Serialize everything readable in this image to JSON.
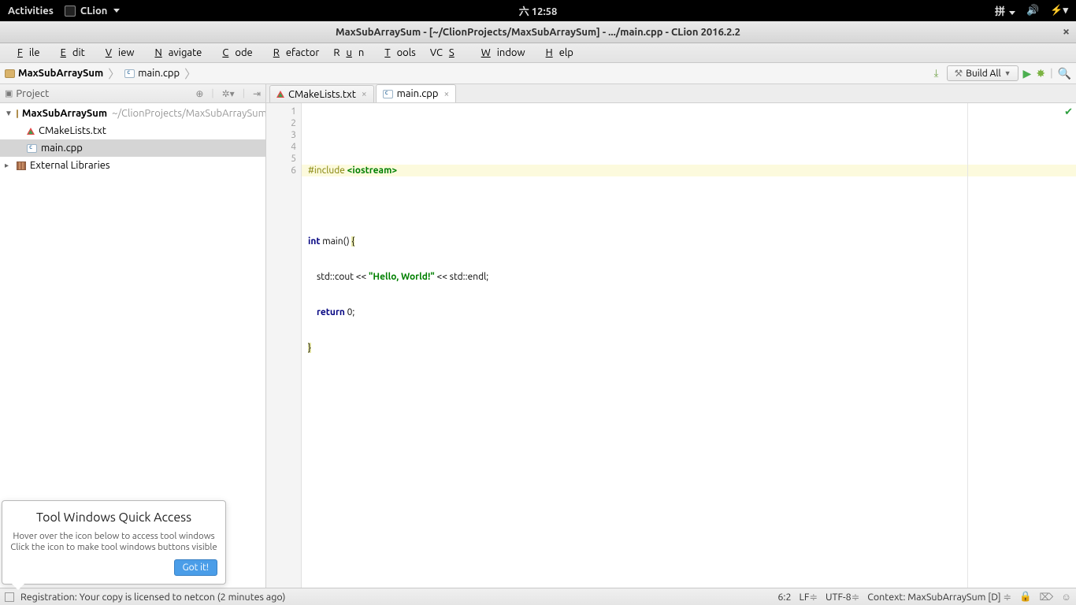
{
  "gnome": {
    "activities": "Activities",
    "app": "CLion",
    "clock": "六 12:58",
    "input": "拼"
  },
  "window": {
    "title": "MaxSubArraySum - [~/ClionProjects/MaxSubArraySum] - .../main.cpp - CLion 2016.2.2"
  },
  "menu": {
    "file": "File",
    "edit": "Edit",
    "view": "View",
    "navigate": "Navigate",
    "code": "Code",
    "refactor": "Refactor",
    "run": "Run",
    "tools": "Tools",
    "vcs": "VCS",
    "window": "Window",
    "help": "Help"
  },
  "breadcrumb": {
    "project": "MaxSubArraySum",
    "file": "main.cpp"
  },
  "toolbar": {
    "build_config": "Build All"
  },
  "project_pane": {
    "title": "Project",
    "root": "MaxSubArraySum",
    "root_path": "~/ClionProjects/MaxSubArraySum",
    "items": [
      "CMakeLists.txt",
      "main.cpp"
    ],
    "external": "External Libraries"
  },
  "tabs": [
    {
      "label": "CMakeLists.txt"
    },
    {
      "label": "main.cpp"
    }
  ],
  "code": {
    "lines": [
      "1",
      "2",
      "3",
      "4",
      "5",
      "6"
    ],
    "l1_a": "#include ",
    "l1_b": "<iostream>",
    "l3_a": "int",
    "l3_b": " main() ",
    "l3_c": "{",
    "l4_a": "    std::cout << ",
    "l4_b": "\"Hello, World!\"",
    "l4_c": " << std::endl;",
    "l5_a": "    ",
    "l5_b": "return",
    "l5_c": " 0;",
    "l6": "}"
  },
  "popup": {
    "title": "Tool Windows Quick Access",
    "line1": "Hover over the icon below to access tool windows",
    "line2": "Click the icon to make tool windows buttons visible",
    "button": "Got it!"
  },
  "status": {
    "msg": "Registration: Your copy is licensed to netcon (2 minutes ago)",
    "pos": "6:2",
    "le": "LF",
    "enc": "UTF-8",
    "ctx": "Context: MaxSubArraySum [D]"
  }
}
